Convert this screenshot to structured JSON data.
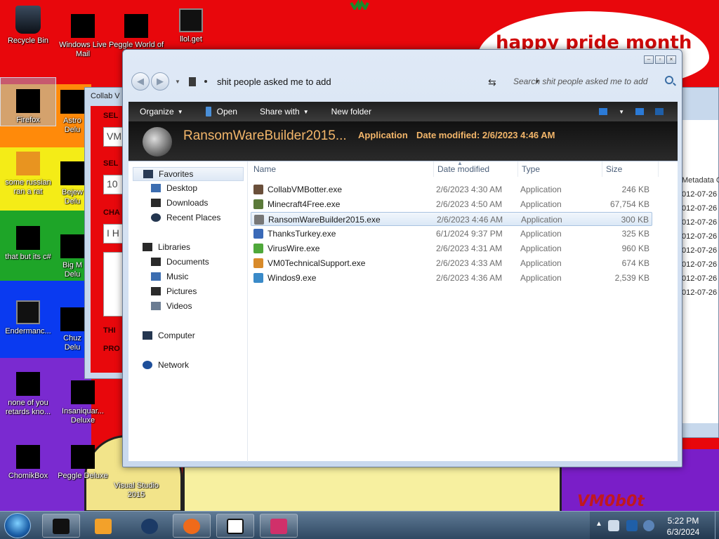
{
  "desktop": {
    "banner": "happy pride month",
    "signature": "VM0b0t",
    "icons": [
      {
        "label": "Recycle Bin"
      },
      {
        "label": "Windows Live Mail"
      },
      {
        "label": "Peggle World of"
      },
      {
        "label": "llol.get"
      },
      {
        "label": "Firefox"
      },
      {
        "label": "Astro Delu"
      },
      {
        "label": "some russian ran a rat"
      },
      {
        "label": "Bejew Delu"
      },
      {
        "label": "that but its c#"
      },
      {
        "label": "Big M Delu"
      },
      {
        "label": "Endermanc..."
      },
      {
        "label": "Chuz Delu"
      },
      {
        "label": "none of you retards kno..."
      },
      {
        "label": "Insaniquar... Deluxe"
      },
      {
        "label": "ChomikBox"
      },
      {
        "label": "Peggle Deluxe"
      },
      {
        "label": "Visual Studio 2015"
      }
    ]
  },
  "bg_window_left": {
    "title": "Collab V",
    "fragments": [
      "SEL",
      "VM",
      "SEL",
      "10",
      "CHA",
      "I H",
      "THI",
      "PRO"
    ]
  },
  "bg_window_right": {
    "header": "Metadata C",
    "rows": [
      "012-07-26",
      "012-07-26",
      "012-07-26",
      "012-07-26",
      "012-07-26",
      "012-07-26",
      "012-07-26",
      "012-07-26",
      "012-07-26"
    ]
  },
  "explorer": {
    "address": "shit people asked me to add",
    "search_placeholder": "Search shit people asked me to add",
    "toolbar": {
      "organize": "Organize",
      "open": "Open",
      "share_with": "Share with",
      "new_folder": "New folder"
    },
    "details": {
      "name": "RansomWareBuilder2015...",
      "type": "Application",
      "date_label": "Date modified:",
      "date_value": "2/6/2023 4:46 AM"
    },
    "nav": {
      "favorites": "Favorites",
      "desktop": "Desktop",
      "downloads": "Downloads",
      "recent": "Recent Places",
      "libraries": "Libraries",
      "documents": "Documents",
      "music": "Music",
      "pictures": "Pictures",
      "videos": "Videos",
      "computer": "Computer",
      "network": "Network"
    },
    "columns": {
      "name": "Name",
      "date": "Date modified",
      "type": "Type",
      "size": "Size"
    },
    "files": [
      {
        "name": "CollabVMBotter.exe",
        "date": "2/6/2023 4:30 AM",
        "type": "Application",
        "size": "246 KB",
        "color": "#6a4f3a"
      },
      {
        "name": "Minecraft4Free.exe",
        "date": "2/6/2023 4:50 AM",
        "type": "Application",
        "size": "67,754 KB",
        "color": "#5b7a3a"
      },
      {
        "name": "RansomWareBuilder2015.exe",
        "date": "2/6/2023 4:46 AM",
        "type": "Application",
        "size": "300 KB",
        "color": "#777777"
      },
      {
        "name": "ThanksTurkey.exe",
        "date": "6/1/2024 9:37 PM",
        "type": "Application",
        "size": "325 KB",
        "color": "#3a6ab8"
      },
      {
        "name": "VirusWire.exe",
        "date": "2/6/2023 4:31 AM",
        "type": "Application",
        "size": "960 KB",
        "color": "#4fa83a"
      },
      {
        "name": "VM0TechnicalSupport.exe",
        "date": "2/6/2023 4:33 AM",
        "type": "Application",
        "size": "674 KB",
        "color": "#d88a2a"
      },
      {
        "name": "Windos9.exe",
        "date": "2/6/2023 4:36 AM",
        "type": "Application",
        "size": "2,539 KB",
        "color": "#3a8ac8"
      }
    ]
  },
  "taskbar": {
    "time": "5:22 PM",
    "date": "6/3/2024"
  }
}
